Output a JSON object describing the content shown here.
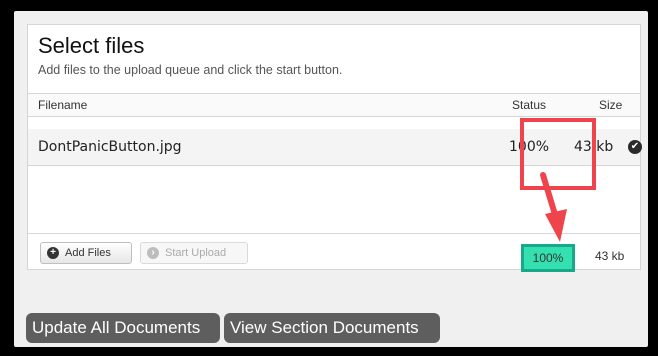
{
  "panel": {
    "title": "Select files",
    "subtitle": "Add files to the upload queue and click the start button."
  },
  "table": {
    "headers": {
      "filename": "Filename",
      "status": "Status",
      "size": "Size"
    },
    "rows": [
      {
        "filename": "DontPanicButton.jpg",
        "status": "100%",
        "size": "43 kb",
        "state_icon": "check-circle-icon"
      }
    ]
  },
  "footer": {
    "add_files_label": "Add Files",
    "start_upload_label": "Start Upload",
    "total_percent": "100%",
    "total_size": "43 kb"
  },
  "actions": {
    "update_all_label": "Update All Documents",
    "view_section_label": "View Section Documents"
  },
  "colors": {
    "highlight_red": "#f0444c",
    "highlight_teal": "#34e0b0",
    "button_dark": "#5e5e5e"
  }
}
